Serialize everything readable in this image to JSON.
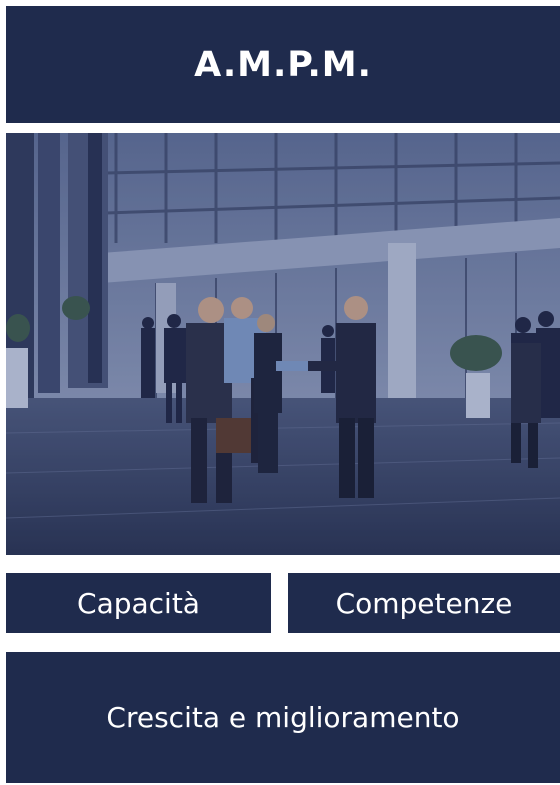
{
  "header": {
    "title": "A.M.P.M."
  },
  "photo": {
    "icon": "business-people-handshake-lobby-photo"
  },
  "tiles": [
    {
      "label": "Capacità"
    },
    {
      "label": "Competenze"
    },
    {
      "label": "Crescita e miglioramento"
    }
  ],
  "colors": {
    "panel_background": "#1f2b4d",
    "text": "#ffffff"
  }
}
